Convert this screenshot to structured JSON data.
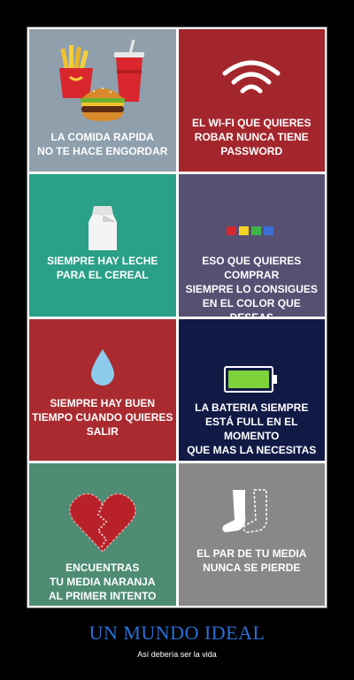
{
  "poster": {
    "title": "UN MUNDO IDEAL",
    "subtitle": "Así debería ser la vida"
  },
  "tiles": [
    {
      "caption": "LA COMIDA RAPIDA\nNO TE HACE ENGORDAR",
      "bg": "#8fa0ac",
      "icon": "fast-food-icon"
    },
    {
      "caption": "EL WI-FI QUE QUIERES\nROBAR NUNCA TIENE\nPASSWORD",
      "bg": "#a4262d",
      "icon": "wifi-icon"
    },
    {
      "caption": "SIEMPRE HAY LECHE\nPARA EL CEREAL",
      "bg": "#2aa088",
      "icon": "milk-carton-icon"
    },
    {
      "caption": "ESO QUE QUIERES COMPRAR\nSIEMPRE LO CONSIGUES\nEN EL COLOR QUE DESEAS",
      "bg": "#565073",
      "icon": "color-swatches-icon"
    },
    {
      "caption": "SIEMPRE HAY BUEN\nTIEMPO CUANDO QUIERES\nSALIR",
      "bg": "#a92b30",
      "icon": "water-drop-icon"
    },
    {
      "caption": "LA BATERIA SIEMPRE\nESTÁ FULL EN EL MOMENTO\nQUE MAS LA NECESITAS",
      "bg": "#111a45",
      "icon": "battery-full-icon"
    },
    {
      "caption": "ENCUENTRAS\nTU MEDIA NARANJA\nAL PRIMER INTENTO",
      "bg": "#4e8c74",
      "icon": "broken-heart-icon"
    },
    {
      "caption": "EL PAR DE TU MEDIA\nNUNCA SE PIERDE",
      "bg": "#888888",
      "icon": "socks-icon"
    }
  ]
}
